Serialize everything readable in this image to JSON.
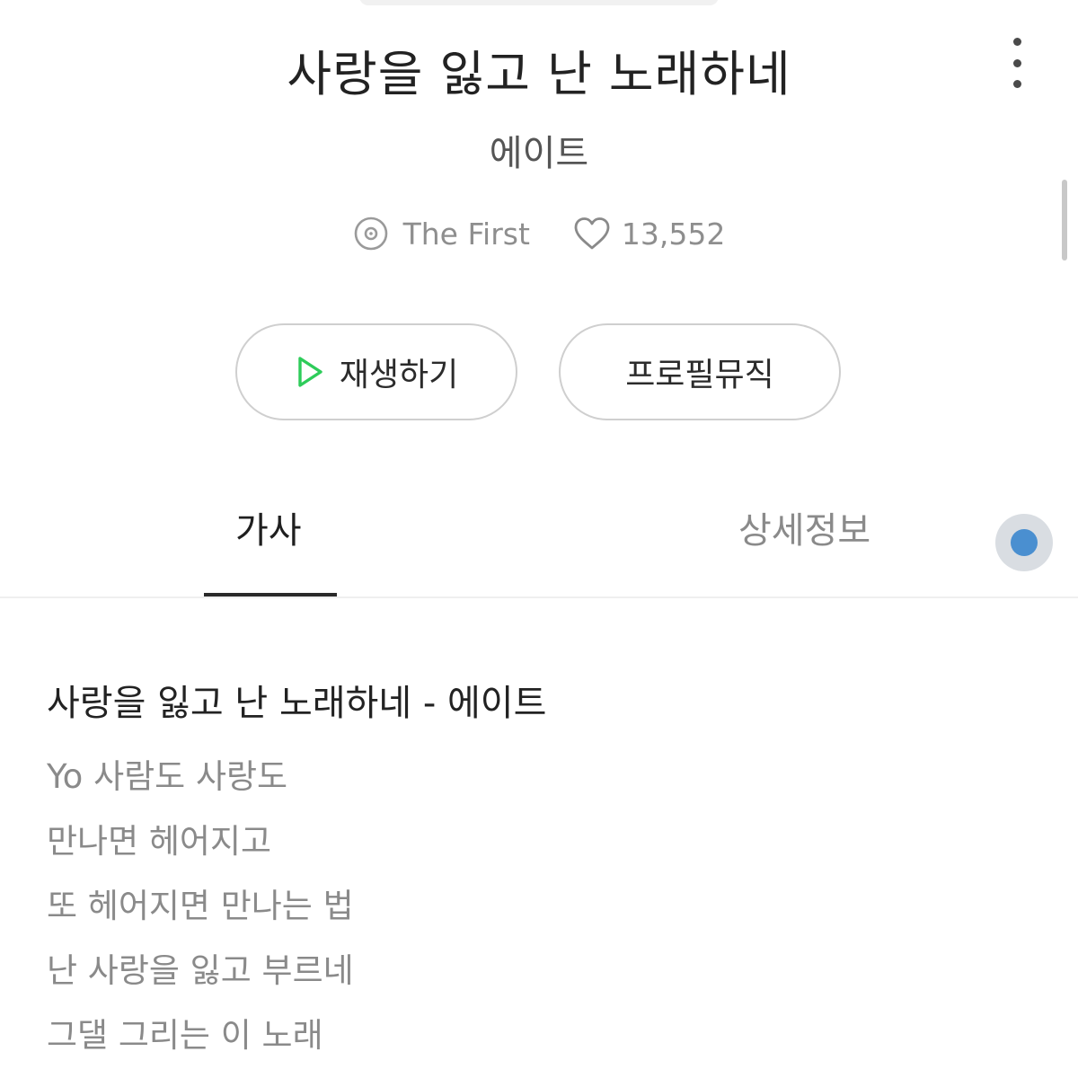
{
  "song": {
    "title": "사랑을 잃고 난 노래하네",
    "artist": "에이트",
    "album": "The First",
    "likes": "13,552"
  },
  "actions": {
    "play_label": "재생하기",
    "profile_music_label": "프로필뮤직"
  },
  "tabs": [
    {
      "label": "가사",
      "selected": true
    },
    {
      "label": "상세정보",
      "selected": false
    }
  ],
  "lyrics": {
    "heading": "사랑을 잃고 난 노래하네 - 에이트",
    "lines": [
      "Yo 사람도 사랑도",
      "만나면 헤어지고",
      "또 헤어지면 만나는 법",
      "난 사랑을 잃고 부르네",
      "그댈 그리는 이 노래"
    ]
  },
  "icons": {
    "more": "more-vertical-icon",
    "album": "disc-icon",
    "likes": "heart-outline-icon",
    "play": "play-outline-icon",
    "assistive": "assistive-touch-icon"
  },
  "colors": {
    "play_icon": "#2ecc5a",
    "assistive_dot": "#4a8fd0",
    "tab_indicator": "#2a2a2a"
  }
}
